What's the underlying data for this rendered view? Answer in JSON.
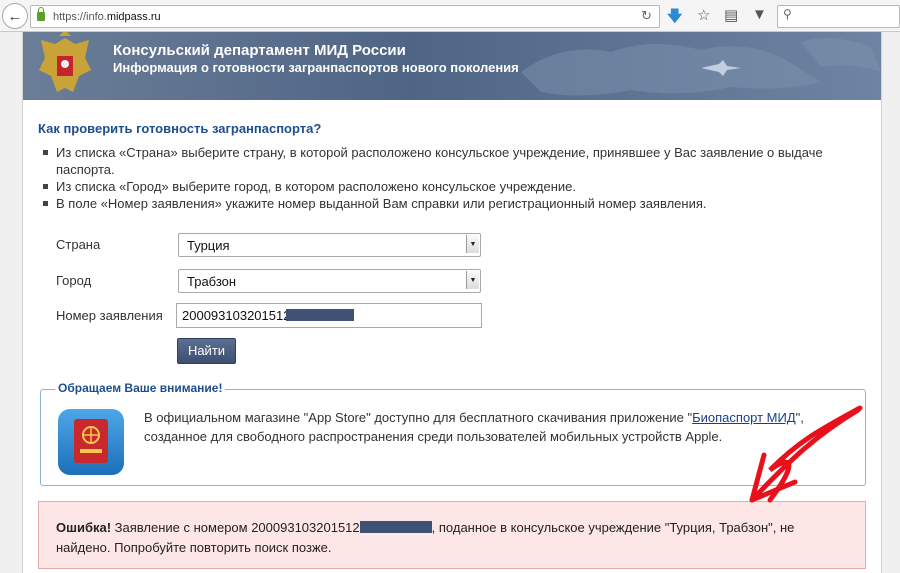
{
  "browser": {
    "url_prefix": "https://info.",
    "url_domain": "midpass.ru"
  },
  "header": {
    "title": "Консульский департамент МИД России",
    "subtitle": "Информация о готовности загранпаспортов нового поколения"
  },
  "instructions": {
    "heading": "Как проверить готовность загранпаспорта?",
    "items": [
      "Из списка «Страна» выберите страну, в которой расположено консульское учреждение, принявшее у Вас заявление о выдаче паспорта.",
      "Из списка «Город» выберите город, в котором расположено консульское учреждение.",
      "В поле «Номер заявления» укажите номер выданной Вам справки или регистрационный номер заявления."
    ]
  },
  "form": {
    "country_label": "Страна",
    "country_value": "Турция",
    "city_label": "Город",
    "city_value": "Трабзон",
    "number_label": "Номер заявления",
    "number_value": "200093103201512",
    "submit_label": "Найти"
  },
  "notice": {
    "legend": "Обращаем Ваше внимание!",
    "text_before": "В официальном магазине \"App Store\" доступно для бесплатного скачивания приложение \"",
    "link_text": "Биопаспорт МИД",
    "text_after": "\", созданное для свободного распространения среди пользователей мобильных устройств Apple."
  },
  "error": {
    "label": "Ошибка!",
    "text_before": "Заявление с номером 200093103201512",
    "text_after": ", поданное в консульское учреждение \"Турция, Трабзон\", не найдено. Попробуйте повторить поиск позже."
  },
  "colors": {
    "banner": "#4f6585",
    "heading": "#1f4e8c",
    "error_bg": "#fde6e6",
    "annotation_arrow": "#e8101a"
  }
}
